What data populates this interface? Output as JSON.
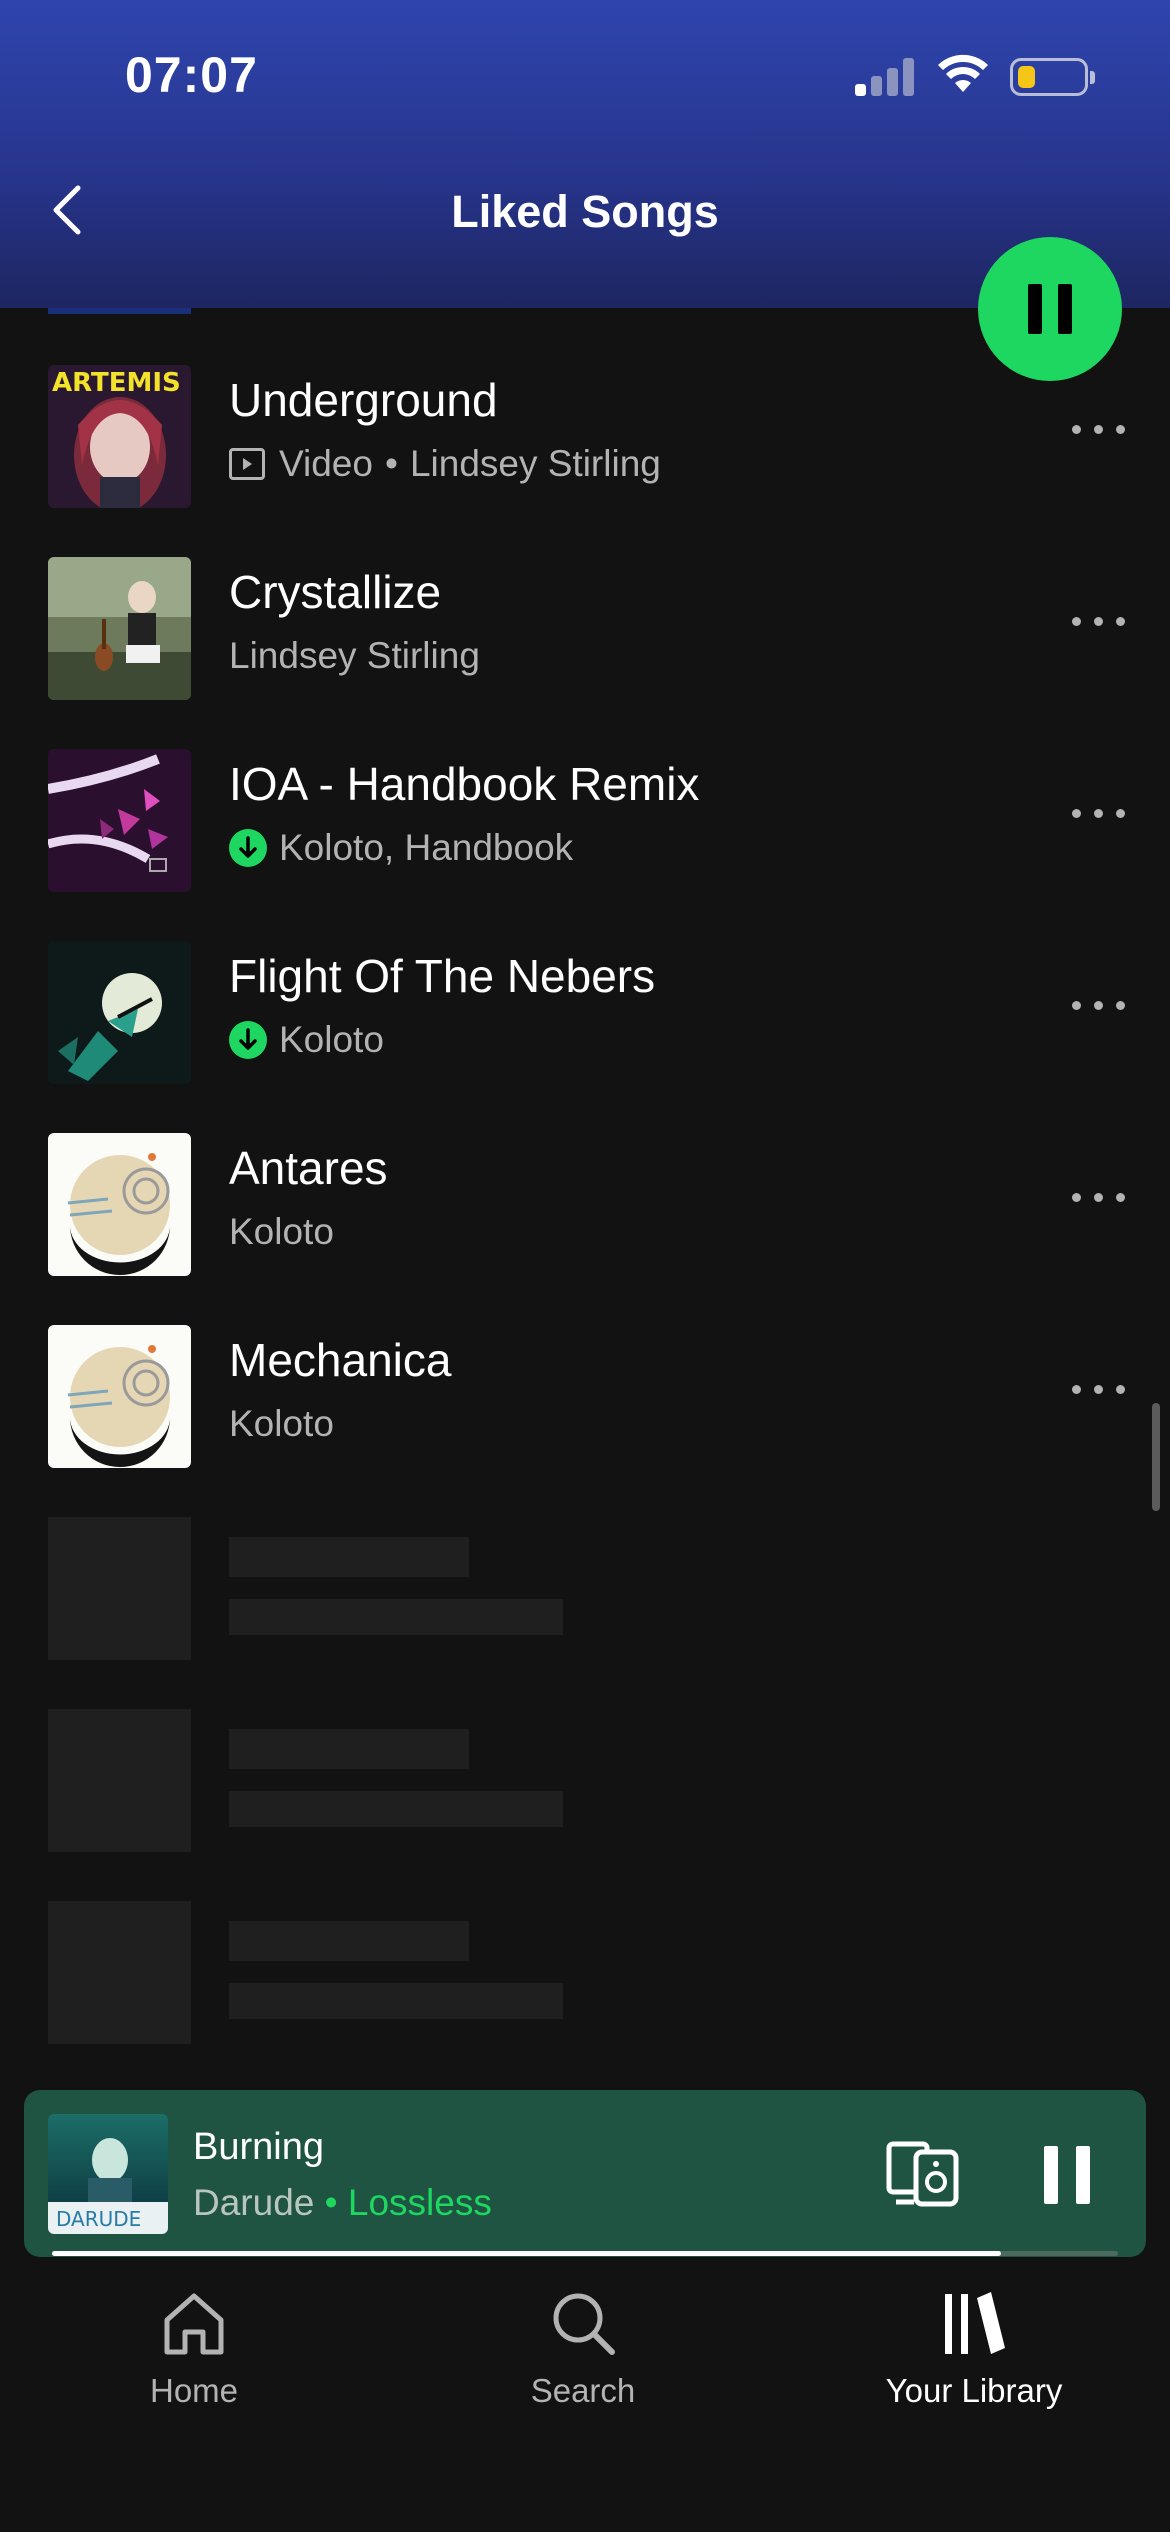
{
  "status_bar": {
    "time": "07:07"
  },
  "header": {
    "title": "Liked Songs"
  },
  "tracks": [
    {
      "title": "Underground",
      "type_label": "Video",
      "artist": "Lindsey Stirling",
      "art_text": "ARTEMIS"
    },
    {
      "title": "Crystallize",
      "artist": "Lindsey Stirling"
    },
    {
      "title": "IOA - Handbook Remix",
      "artist": "Koloto, Handbook",
      "downloaded": true
    },
    {
      "title": "Flight Of The Nebers",
      "artist": "Koloto",
      "downloaded": true
    },
    {
      "title": "Antares",
      "artist": "Koloto"
    },
    {
      "title": "Mechanica",
      "artist": "Koloto"
    }
  ],
  "now_playing": {
    "title": "Burning",
    "artist": "Darude",
    "separator": "•",
    "quality": "Lossless",
    "art_text": "DARUDE",
    "progress": 0.89
  },
  "bottom_nav": {
    "home": "Home",
    "search": "Search",
    "library": "Your Library"
  },
  "colors": {
    "accent": "#1ed760",
    "background": "#121212",
    "header_top": "#2f45ae",
    "mini_player": "#1f5442"
  }
}
